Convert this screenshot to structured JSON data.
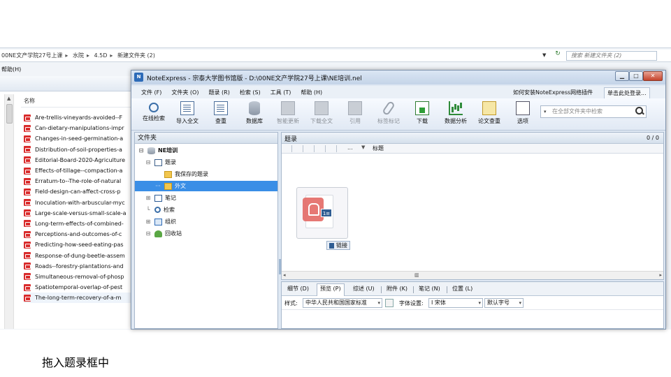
{
  "explorer": {
    "path": [
      "00NE文产学院27号上课",
      "水院",
      "4.5D",
      "新建文件夹 (2)"
    ],
    "search_placeholder": "搜索 新建文件夹 (2)",
    "menu": "帮助(H)",
    "column_header": "名称",
    "files": [
      "Are-trellis-vineyards-avoided--F",
      "Can-dietary-manipulations-impr",
      "Changes-in-seed-germination-a",
      "Distribution-of-soil-properties-a",
      "Editorial-Board-2020-Agriculture",
      "Effects-of-tillage--compaction-a",
      "Erratum-to--The-role-of-natural",
      "Field-design-can-affect-cross-p",
      "Inoculation-with-arbuscular-myc",
      "Large-scale-versus-small-scale-a",
      "Long-term-effects-of-combined-",
      "Perceptions-and-outcomes-of-c",
      "Predicting-how-seed-eating-pas",
      "Response-of-dung-beetle-assem",
      "Roads--forestry-plantations-and",
      "Simultaneous-removal-of-phosp",
      "Spatiotemporal-overlap-of-pest",
      "The-long-term-recovery-of-a-m"
    ]
  },
  "ne": {
    "title": "NoteExpress - 宗泰大学图书馆版 - D:\\00NE文产学院27号上课\\NE培训.nel",
    "menu": [
      "文件 (F)",
      "文件夹 (O)",
      "题录 (R)",
      "检索 (S)",
      "工具 (T)",
      "帮助 (H)"
    ],
    "help_link": "如何安装NoteExpress网络插件",
    "login": "单击此处登录...",
    "toolbar": [
      {
        "label": "在线检索",
        "icon": "online-search-icon",
        "disabled": false
      },
      {
        "label": "导入全文",
        "icon": "import-fulltext-icon",
        "disabled": false
      },
      {
        "label": "查重",
        "icon": "dedupe-icon",
        "disabled": false
      },
      {
        "label": "数据库",
        "icon": "database-icon",
        "disabled": false
      },
      {
        "label": "智能更新",
        "icon": "smart-update-icon",
        "disabled": true
      },
      {
        "label": "下载全文",
        "icon": "download-fulltext-icon",
        "disabled": true
      },
      {
        "label": "引用",
        "icon": "cite-icon",
        "disabled": true
      },
      {
        "label": "标签标记",
        "icon": "tag-icon",
        "disabled": true
      },
      {
        "label": "下载",
        "icon": "download-icon",
        "disabled": false
      },
      {
        "label": "数据分析",
        "icon": "data-analysis-icon",
        "disabled": false
      },
      {
        "label": "论文查重",
        "icon": "paper-check-icon",
        "disabled": false
      },
      {
        "label": "选项",
        "icon": "options-icon",
        "disabled": false
      }
    ],
    "search_placeholder": "在全部文件夹中检索",
    "folder_pane_title": "文件夹",
    "tree": [
      {
        "label": "NE培训",
        "level": 0,
        "toggle": "⊟",
        "icon": "db",
        "bold": true
      },
      {
        "label": "题录",
        "level": 1,
        "toggle": "⊟",
        "icon": "list"
      },
      {
        "label": "我保存的题录",
        "level": 2,
        "toggle": "",
        "icon": "folder"
      },
      {
        "label": "外文",
        "level": 2,
        "toggle": "···",
        "icon": "folder",
        "selected": true
      },
      {
        "label": "笔记",
        "level": 1,
        "toggle": "⊞",
        "icon": "book"
      },
      {
        "label": "检索",
        "level": 1,
        "toggle": "└",
        "icon": "mag"
      },
      {
        "label": "组织",
        "level": 1,
        "toggle": "⊞",
        "icon": "org"
      },
      {
        "label": "回收站",
        "level": 1,
        "toggle": "⊟",
        "icon": "tree"
      }
    ],
    "records_title": "题录",
    "records_count": "0 / 0",
    "grid_dots": "...",
    "grid_title_col": "标题",
    "drag_badge": "1≡",
    "drag_tip": "链接",
    "tabs": [
      "细节 (D)",
      "预览 (P)",
      "综述 (U)",
      "附件 (K)",
      "笔记 (N)",
      "位置 (L)"
    ],
    "active_tab": 1,
    "style_label": "样式:",
    "style_value": "中华人民共和国国家标准",
    "font_label": "字体设置:",
    "font_value": "Ⅰ 宋体",
    "font_size": "默认字号"
  },
  "caption": "拖入题录框中"
}
